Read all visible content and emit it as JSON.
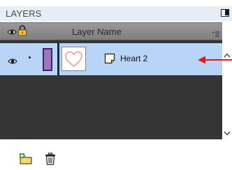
{
  "panel": {
    "title": "LAYERS",
    "maximize_icon": "maximize-icon"
  },
  "columns": {
    "visibility_icon": "eye-icon",
    "lock_icon": "lock-icon",
    "layer_name_label": "Layer Name",
    "menu_icon": "panel-menu-icon"
  },
  "layers": [
    {
      "name": "Heart 2",
      "visible": true,
      "locked": false,
      "color": "#9e74c4",
      "thumbnail": "heart-outline-icon",
      "type_icon": "note-icon",
      "selected": true
    }
  ],
  "toolbar": {
    "new_folder_icon": "new-folder-icon",
    "delete_icon": "trash-icon"
  },
  "colors": {
    "selected_row": "#b8d5f7",
    "empty_area": "#353535",
    "header": "#e7edf4",
    "annotation_arrow": "#e01818"
  }
}
